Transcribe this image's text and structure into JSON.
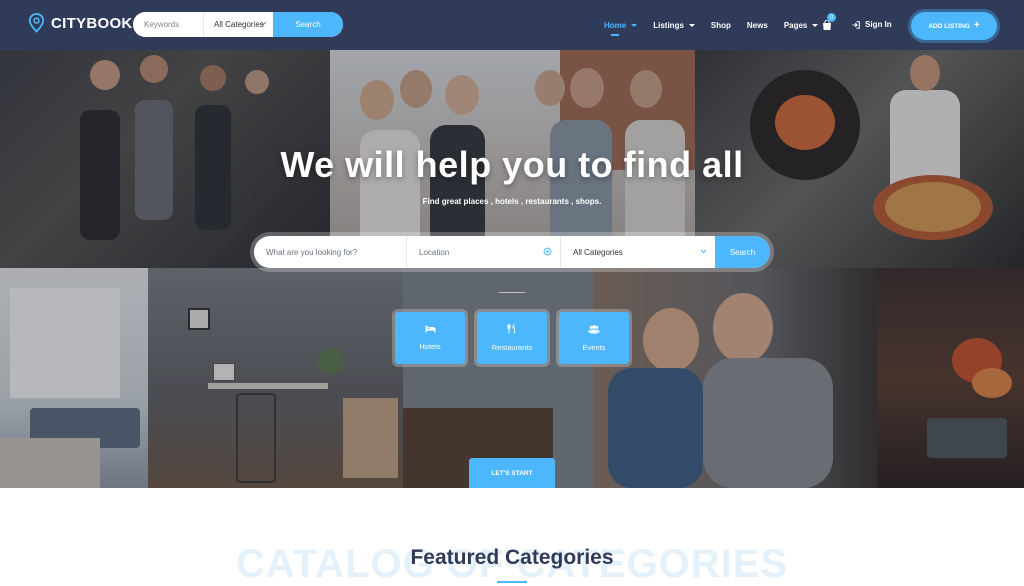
{
  "brand": {
    "name": "CITYBOOK"
  },
  "header_search": {
    "keywords_placeholder": "Keywords",
    "category": "All Categories",
    "button": "Search"
  },
  "nav": {
    "items": [
      {
        "label": "Home",
        "active": true,
        "dropdown": true
      },
      {
        "label": "Listings",
        "active": false,
        "dropdown": true
      },
      {
        "label": "Shop",
        "active": false,
        "dropdown": false
      },
      {
        "label": "News",
        "active": false,
        "dropdown": false
      },
      {
        "label": "Pages",
        "active": false,
        "dropdown": true
      }
    ],
    "cart_count": "0",
    "sign_in": "Sign In",
    "add_listing": "ADD LISTING"
  },
  "hero": {
    "title": "We will help you to find all",
    "subtitle": "Find great places , hotels , restaurants , shops.",
    "search": {
      "what_placeholder": "What are you looking for?",
      "location_placeholder": "Location",
      "category": "All Categories",
      "button": "Search"
    },
    "categories": [
      {
        "label": "Hotels",
        "icon": "bed-icon"
      },
      {
        "label": "Restaurants",
        "icon": "cutlery-icon"
      },
      {
        "label": "Events",
        "icon": "users-icon"
      }
    ],
    "start_button": "LET'S START"
  },
  "featured": {
    "watermark": "CATALOG OF CATEGORIES",
    "title": "Featured Categories"
  },
  "colors": {
    "header_bg": "#2f3b59",
    "accent": "#4db7fe",
    "title_text": "#2f3b59"
  }
}
